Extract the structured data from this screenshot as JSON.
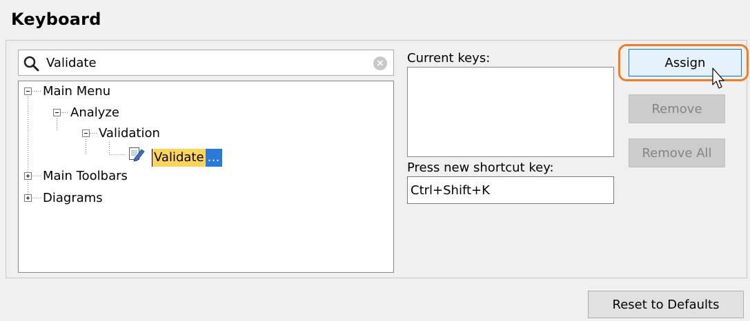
{
  "page": {
    "title": "Keyboard"
  },
  "search": {
    "value": "Validate"
  },
  "tree": {
    "nodes": [
      {
        "label": "Main Menu",
        "toggle": "minus"
      },
      {
        "label": "Analyze",
        "toggle": "minus"
      },
      {
        "label": "Validation",
        "toggle": "minus"
      },
      {
        "label": "Validate",
        "selected": true,
        "ellipsis": "…"
      },
      {
        "label": "Main Toolbars",
        "toggle": "plus"
      },
      {
        "label": "Diagrams",
        "toggle": "plus"
      }
    ]
  },
  "current_keys": {
    "label": "Current keys:"
  },
  "shortcut": {
    "label": "Press new shortcut key:",
    "value": "Ctrl+Shift+K"
  },
  "buttons": {
    "assign": "Assign",
    "remove": "Remove",
    "remove_all": "Remove All",
    "reset": "Reset to Defaults"
  },
  "colors": {
    "highlight_ring": "#f07d23",
    "selection_text_bg": "#ffd45a",
    "selection_ellipsis_bg": "#2b79d8"
  }
}
